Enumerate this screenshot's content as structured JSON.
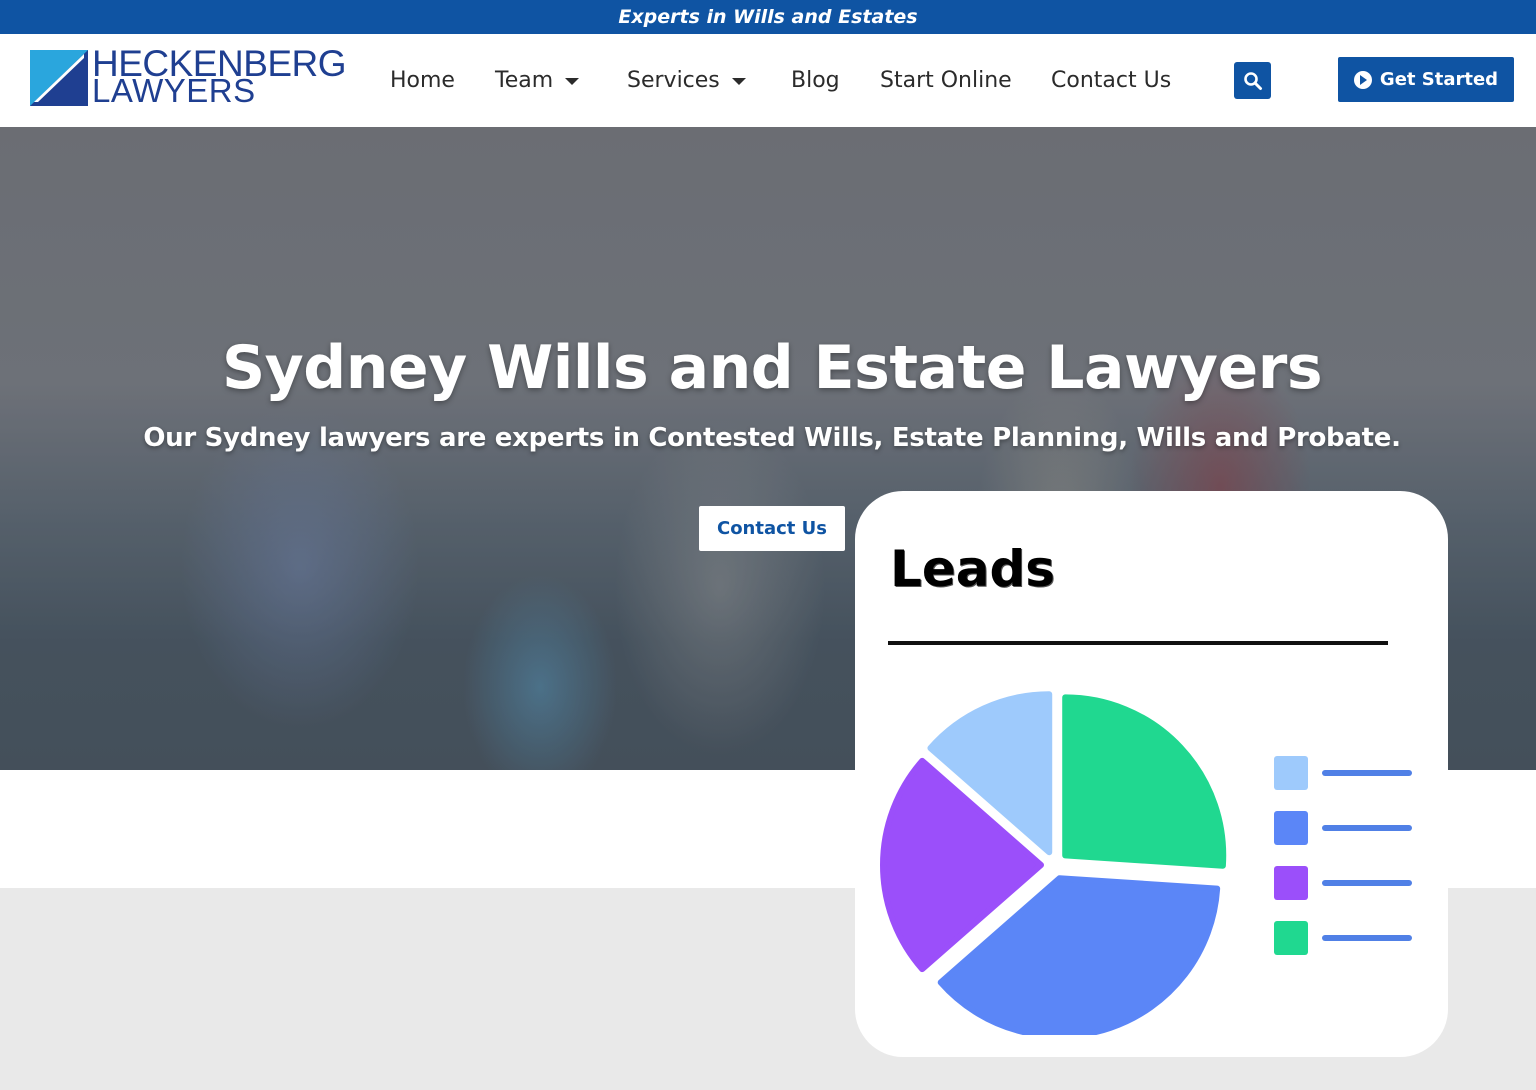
{
  "banner": {
    "text": "Experts in Wills and Estates"
  },
  "header": {
    "logo": {
      "line1": "HECKENBERG",
      "line2": "LAWYERS"
    },
    "nav": [
      {
        "label": "Home",
        "has_dropdown": false
      },
      {
        "label": "Team",
        "has_dropdown": true
      },
      {
        "label": "Services",
        "has_dropdown": true
      },
      {
        "label": "Blog",
        "has_dropdown": false
      },
      {
        "label": "Start Online",
        "has_dropdown": false
      },
      {
        "label": "Contact Us",
        "has_dropdown": false
      }
    ],
    "search_icon": "search-icon",
    "cta_label": "Get Started",
    "cta_icon": "chevron-circle-right-icon"
  },
  "hero": {
    "title": "Sydney Wills and Estate Lawyers",
    "subtitle": "Our Sydney lawyers are experts in Contested Wills, Estate Planning, Wills and Probate.",
    "button_label": "Contact Us"
  },
  "leads_card": {
    "title": "Leads",
    "chart_data": {
      "type": "pie",
      "title": "Leads",
      "series": [
        {
          "values": [
            25,
            36,
            22,
            13
          ],
          "colors": [
            "#20d890",
            "#5b86f7",
            "#9b4ffa",
            "#9ecafc"
          ]
        }
      ],
      "legend": {
        "placement": "right",
        "entries": [
          "",
          "",
          "",
          ""
        ],
        "colors": [
          "#9ecafc",
          "#5b86f7",
          "#9b4ffa",
          "#20d890"
        ]
      }
    }
  },
  "colors": {
    "brand_blue": "#0f54a3",
    "logo_blue": "#1f3f91"
  }
}
